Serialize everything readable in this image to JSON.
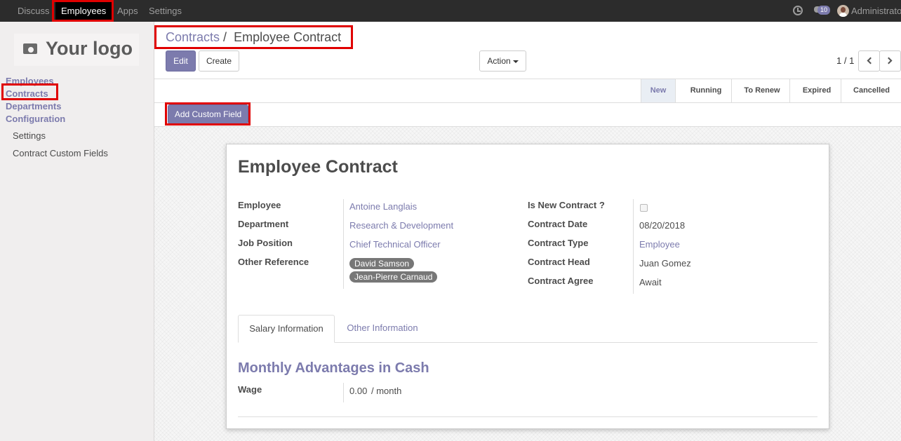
{
  "topbar": {
    "menus": [
      "Discuss",
      "Employees",
      "Apps",
      "Settings"
    ],
    "notification_count": "10",
    "user": "Administrator"
  },
  "sidebar": {
    "logo_text": "Your logo",
    "items": [
      "Employees",
      "Contracts",
      "Departments",
      "Configuration"
    ],
    "config_items": [
      "Settings",
      "Contract Custom Fields"
    ]
  },
  "breadcrumb": {
    "parent": "Contracts",
    "separator": "/",
    "current": "Employee Contract"
  },
  "buttons": {
    "edit": "Edit",
    "create": "Create",
    "action": "Action",
    "add_custom_field": "Add Custom Field"
  },
  "pager": {
    "value": "1 / 1"
  },
  "stages": [
    "New",
    "Running",
    "To Renew",
    "Expired",
    "Cancelled"
  ],
  "form": {
    "title": "Employee Contract",
    "left_fields": [
      {
        "label": "Employee",
        "value": "Antoine Langlais"
      },
      {
        "label": "Department",
        "value": "Research & Development"
      },
      {
        "label": "Job Position",
        "value": "Chief Technical Officer"
      },
      {
        "label": "Other Reference",
        "tags": [
          "David Samson",
          "Jean-Pierre Carnaud"
        ]
      }
    ],
    "right_fields": [
      {
        "label": "Is New Contract ?",
        "value": ""
      },
      {
        "label": "Contract Date",
        "value": "08/20/2018"
      },
      {
        "label": "Contract Type",
        "value": "Employee"
      },
      {
        "label": "Contract Head",
        "value": "Juan Gomez"
      },
      {
        "label": "Contract Agree",
        "value": "Await"
      }
    ],
    "tabs": [
      "Salary Information",
      "Other Information"
    ],
    "section_title": "Monthly Advantages in Cash",
    "wage_label": "Wage",
    "wage_value": "0.00",
    "wage_unit": "/ month"
  },
  "colors": {
    "accent": "#7c7bad",
    "topbar": "#2c2c2c",
    "highlight": "#e00000"
  }
}
